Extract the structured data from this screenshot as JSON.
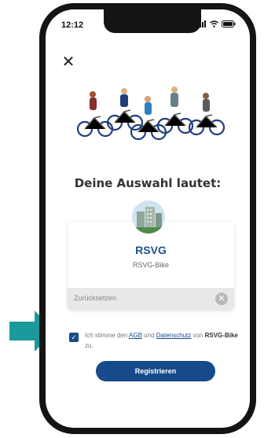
{
  "status": {
    "time": "12:12"
  },
  "heading": "Deine Auswahl lautet:",
  "provider": {
    "name": "RSVG",
    "subtitle": "RSVG-Bike"
  },
  "reset": {
    "label": "Zurücksetzen"
  },
  "consent": {
    "prefix": "Ich stimme den",
    "agb": "AGB",
    "und": "und",
    "datenschutz": "Datenschutz",
    "von": "von",
    "brand": "RSVG-Bike",
    "suffix": "zu.",
    "checked": true
  },
  "register_button": "Registrieren",
  "colors": {
    "primary": "#174a8a",
    "arrow": "#1a9a9a",
    "phone_frame": "#141414"
  }
}
